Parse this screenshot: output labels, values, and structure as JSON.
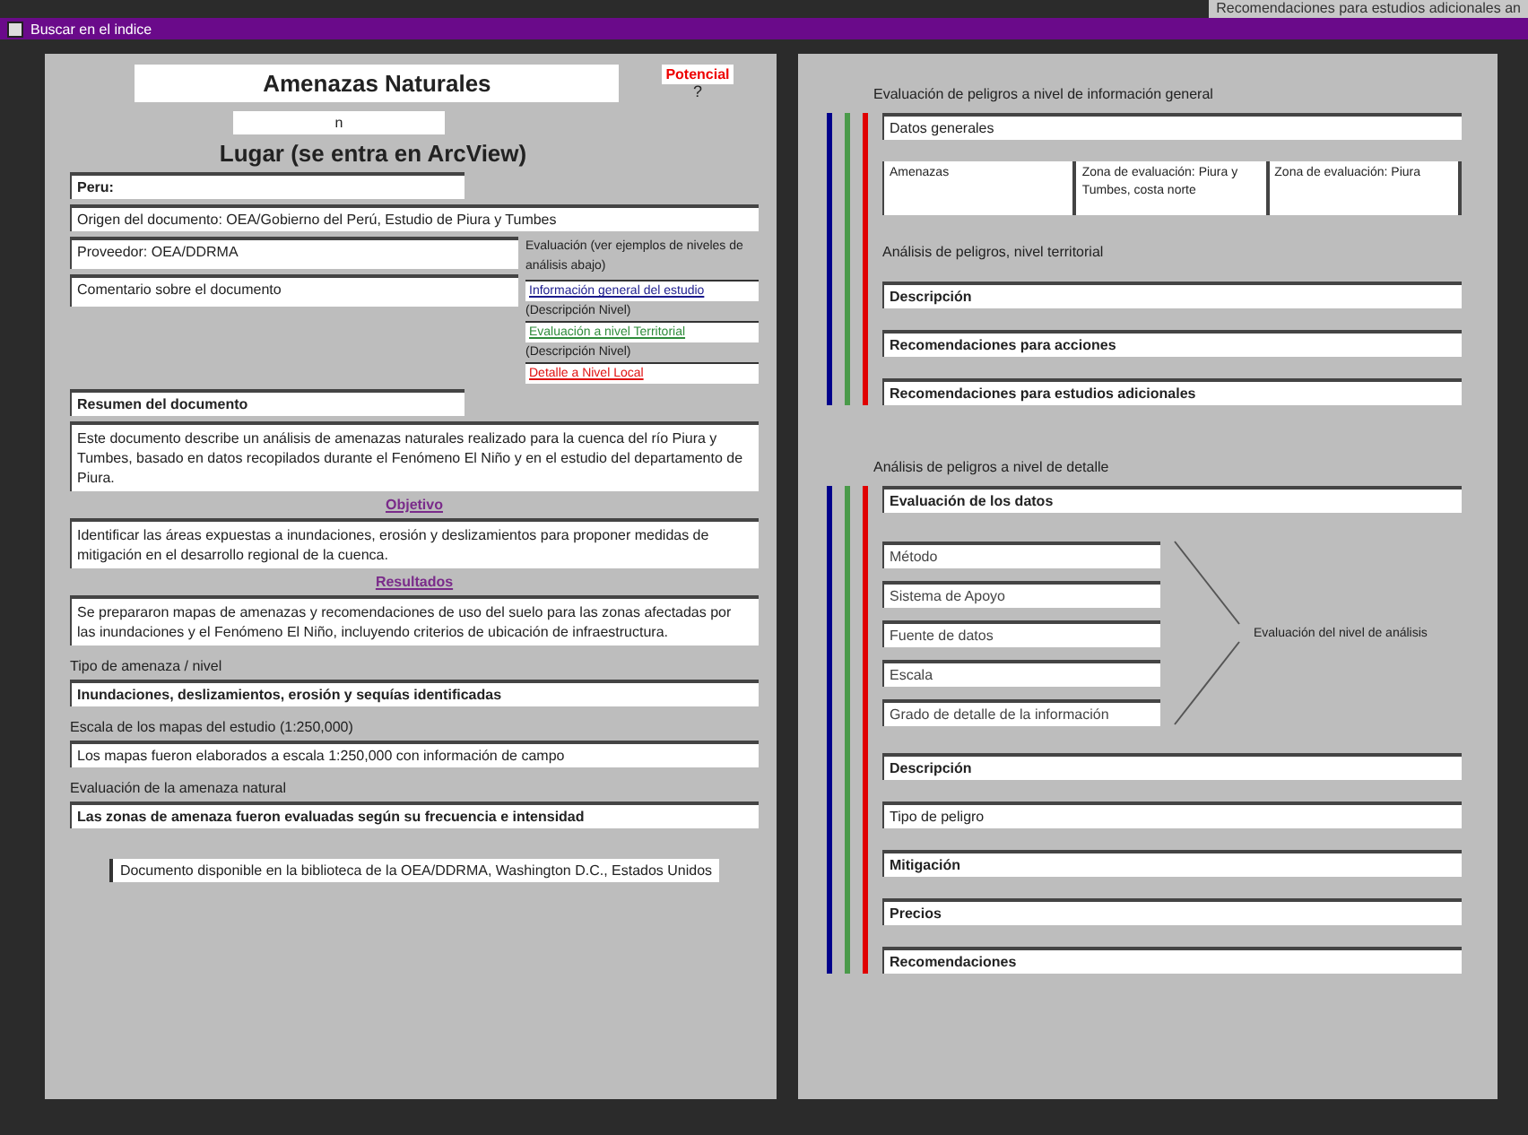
{
  "top_strip": "Recomendaciones para estudios adicionales an",
  "window": {
    "title": "Buscar en el indice"
  },
  "left": {
    "title": "Amenazas Naturales",
    "potential_link": "Potencial",
    "help": "?",
    "code": "n",
    "place_heading": "Lugar (se entra en ArcView)",
    "fields_top": [
      {
        "value": "Peru:",
        "bold": true,
        "wide": false
      },
      {
        "value": "Origen del documento: OEA/Gobierno del Perú, Estudio de Piura y Tumbes",
        "bold": false,
        "wide": true
      }
    ],
    "fields_mid": [
      "Proveedor: OEA/DDRMA",
      "Comentario sobre el documento"
    ],
    "side_note": "Evaluación (ver ejemplos de niveles de análisis abajo)",
    "level_links": [
      {
        "label": "Información general del estudio",
        "color": "#1a1a8c",
        "note": "(Descripción Nivel)"
      },
      {
        "label": "Evaluación a nivel Territorial",
        "color": "#2e8b3a",
        "note": "(Descripción Nivel)"
      },
      {
        "label": "Detalle a Nivel Local",
        "color": "#e01010"
      }
    ],
    "summary_label": "Resumen del documento",
    "summary": "Este documento describe un análisis de amenazas naturales realizado para la cuenca del río Piura y Tumbes, basado en datos recopilados durante el Fenómeno El Niño y en el estudio del departamento de Piura.",
    "sections": [
      {
        "link": "Objetivo",
        "text": "Identificar las áreas expuestas a inundaciones, erosión y deslizamientos para proponer medidas de mitigación en el desarrollo regional de la cuenca."
      },
      {
        "link": "Resultados",
        "text": "Se prepararon mapas de amenazas y recomendaciones de uso del suelo para las zonas afectadas por las inundaciones y el Fenómeno El Niño, incluyendo criterios de ubicación de infraestructura."
      }
    ],
    "labeled_fields": [
      {
        "label": "Tipo de amenaza / nivel",
        "value": "Inundaciones, deslizamientos, erosión y sequías identificadas",
        "bold": true
      },
      {
        "label": "Escala de los mapas del estudio (1:250,000)",
        "value": "Los mapas fueron elaborados a escala 1:250,000 con información de campo",
        "bold": false
      },
      {
        "label": "Evaluación de la amenaza natural",
        "value": "Las zonas de amenaza fueron evaluadas según su frecuencia e intensidad",
        "bold": true
      }
    ],
    "footer": "Documento disponible en la biblioteca de la OEA/DDRMA, Washington D.C., Estados Unidos"
  },
  "right": {
    "groups": [
      {
        "heading": "Evaluación de peligros a nivel de información general",
        "bars": [
          {
            "color": "#00008b"
          },
          {
            "color": "#4a9a4a"
          },
          {
            "color": "#e00000"
          }
        ],
        "items": [
          {
            "kind": "field",
            "value": "Datos generales",
            "bold": false
          },
          {
            "kind": "row",
            "cells": [
              "Amenazas",
              "Zona de evaluación: Piura y Tumbes, costa norte",
              "Zona de evaluación: Piura"
            ]
          },
          {
            "kind": "label",
            "value": "Análisis de peligros, nivel territorial"
          },
          {
            "kind": "field",
            "value": "Descripción",
            "bold": true
          },
          {
            "kind": "field",
            "value": "Recomendaciones para acciones",
            "bold": true
          },
          {
            "kind": "field",
            "value": "Recomendaciones para estudios adicionales",
            "bold": true
          }
        ]
      },
      {
        "heading": "Análisis de peligros a nivel de detalle",
        "bars": [
          {
            "color": "#00008b"
          },
          {
            "color": "#4a9a4a"
          },
          {
            "color": "#e00000"
          }
        ],
        "items": [
          {
            "kind": "field",
            "value": "Evaluación de los datos",
            "bold": true
          },
          {
            "kind": "bracket",
            "values": [
              "Método",
              "Sistema de Apoyo",
              "Fuente de datos",
              "Escala",
              "Grado de detalle de la información"
            ],
            "note": "Evaluación del nivel de análisis"
          },
          {
            "kind": "field",
            "value": "Descripción",
            "bold": true
          },
          {
            "kind": "field",
            "value": "Tipo de peligro",
            "bold": false
          },
          {
            "kind": "field",
            "value": "Mitigación",
            "bold": true
          },
          {
            "kind": "field",
            "value": "Precios",
            "bold": true
          },
          {
            "kind": "field",
            "value": "Recomendaciones",
            "bold": true
          }
        ]
      }
    ]
  }
}
